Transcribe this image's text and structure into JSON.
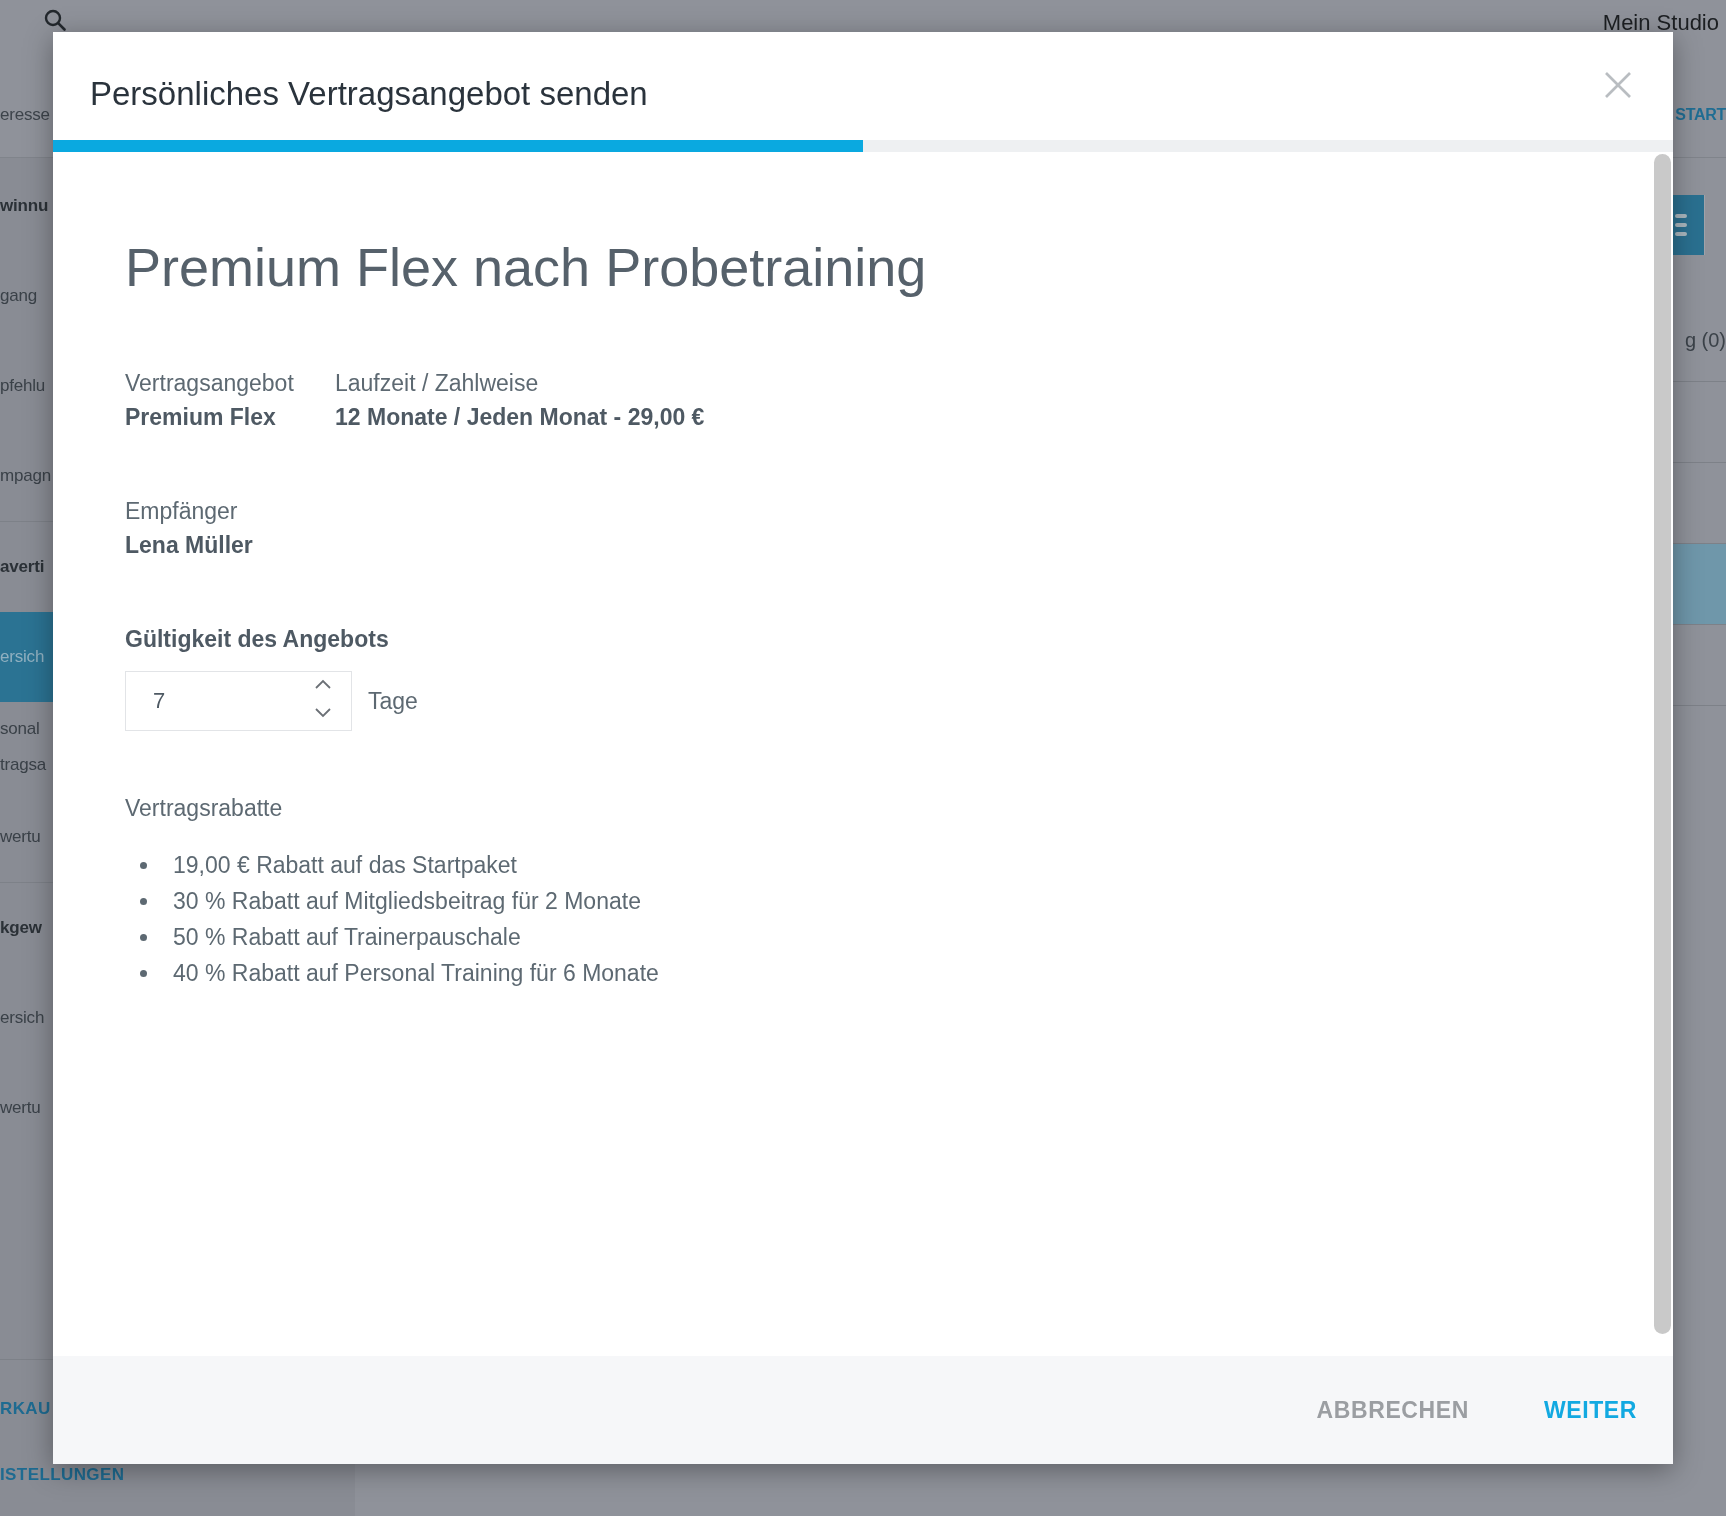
{
  "background": {
    "top_bar": {
      "studio_name": "Mein Studio"
    },
    "header_row": {
      "page_title": "eresse",
      "start_label": "START"
    },
    "sidebar": {
      "groups": [
        {
          "items": [
            {
              "label": "winnu",
              "kind": "section",
              "selected": false
            },
            {
              "label": "gang",
              "kind": "item",
              "selected": false
            },
            {
              "label": "pfehlu",
              "kind": "item",
              "selected": false
            },
            {
              "label": "mpagn",
              "kind": "item",
              "selected": false
            }
          ]
        },
        {
          "items": [
            {
              "label": "averti",
              "kind": "section",
              "selected": false
            },
            {
              "label": "ersich",
              "kind": "item",
              "selected": true
            },
            {
              "label": "sonal\ntragsa",
              "kind": "item",
              "selected": false
            },
            {
              "label": "wertu",
              "kind": "item",
              "selected": false
            }
          ]
        },
        {
          "items": [
            {
              "label": "kgew",
              "kind": "section",
              "selected": false
            },
            {
              "label": "ersich",
              "kind": "item",
              "selected": false
            },
            {
              "label": "wertu",
              "kind": "item",
              "selected": false
            }
          ]
        }
      ],
      "links": [
        "RKAU",
        "ISTELLUNGEN"
      ]
    },
    "content": {
      "tab_label": "g (0)",
      "rows": [
        {
          "selected": false
        },
        {
          "selected": false
        },
        {
          "selected": true
        },
        {
          "selected": false
        }
      ]
    }
  },
  "modal": {
    "title": "Persönliches Vertragsangebot senden",
    "progress": {
      "level": 0.5
    },
    "heading": "Premium Flex nach Probetraining",
    "details": [
      {
        "label": "Vertragsangebot",
        "value": "Premium Flex"
      },
      {
        "label": "Laufzeit / Zahlweise",
        "value": "12 Monate / Jeden Monat - 29,00 €"
      }
    ],
    "recipient": {
      "label": "Empfänger",
      "value": "Lena Müller"
    },
    "validity": {
      "label": "Gültigkeit des Angebots",
      "value": "7",
      "unit": "Tage"
    },
    "discounts": {
      "label": "Vertragsrabatte",
      "items": [
        "19,00 € Rabatt auf das Startpaket",
        "30 % Rabatt auf Mitgliedsbeitrag für 2 Monate",
        "50 % Rabatt auf Trainerpauschale",
        "40 % Rabatt auf Personal Training für 6 Monate"
      ]
    },
    "buttons": [
      {
        "label": "ABBRECHEN",
        "kind": "cancel"
      },
      {
        "label": "WEITER",
        "kind": "submit"
      }
    ]
  }
}
